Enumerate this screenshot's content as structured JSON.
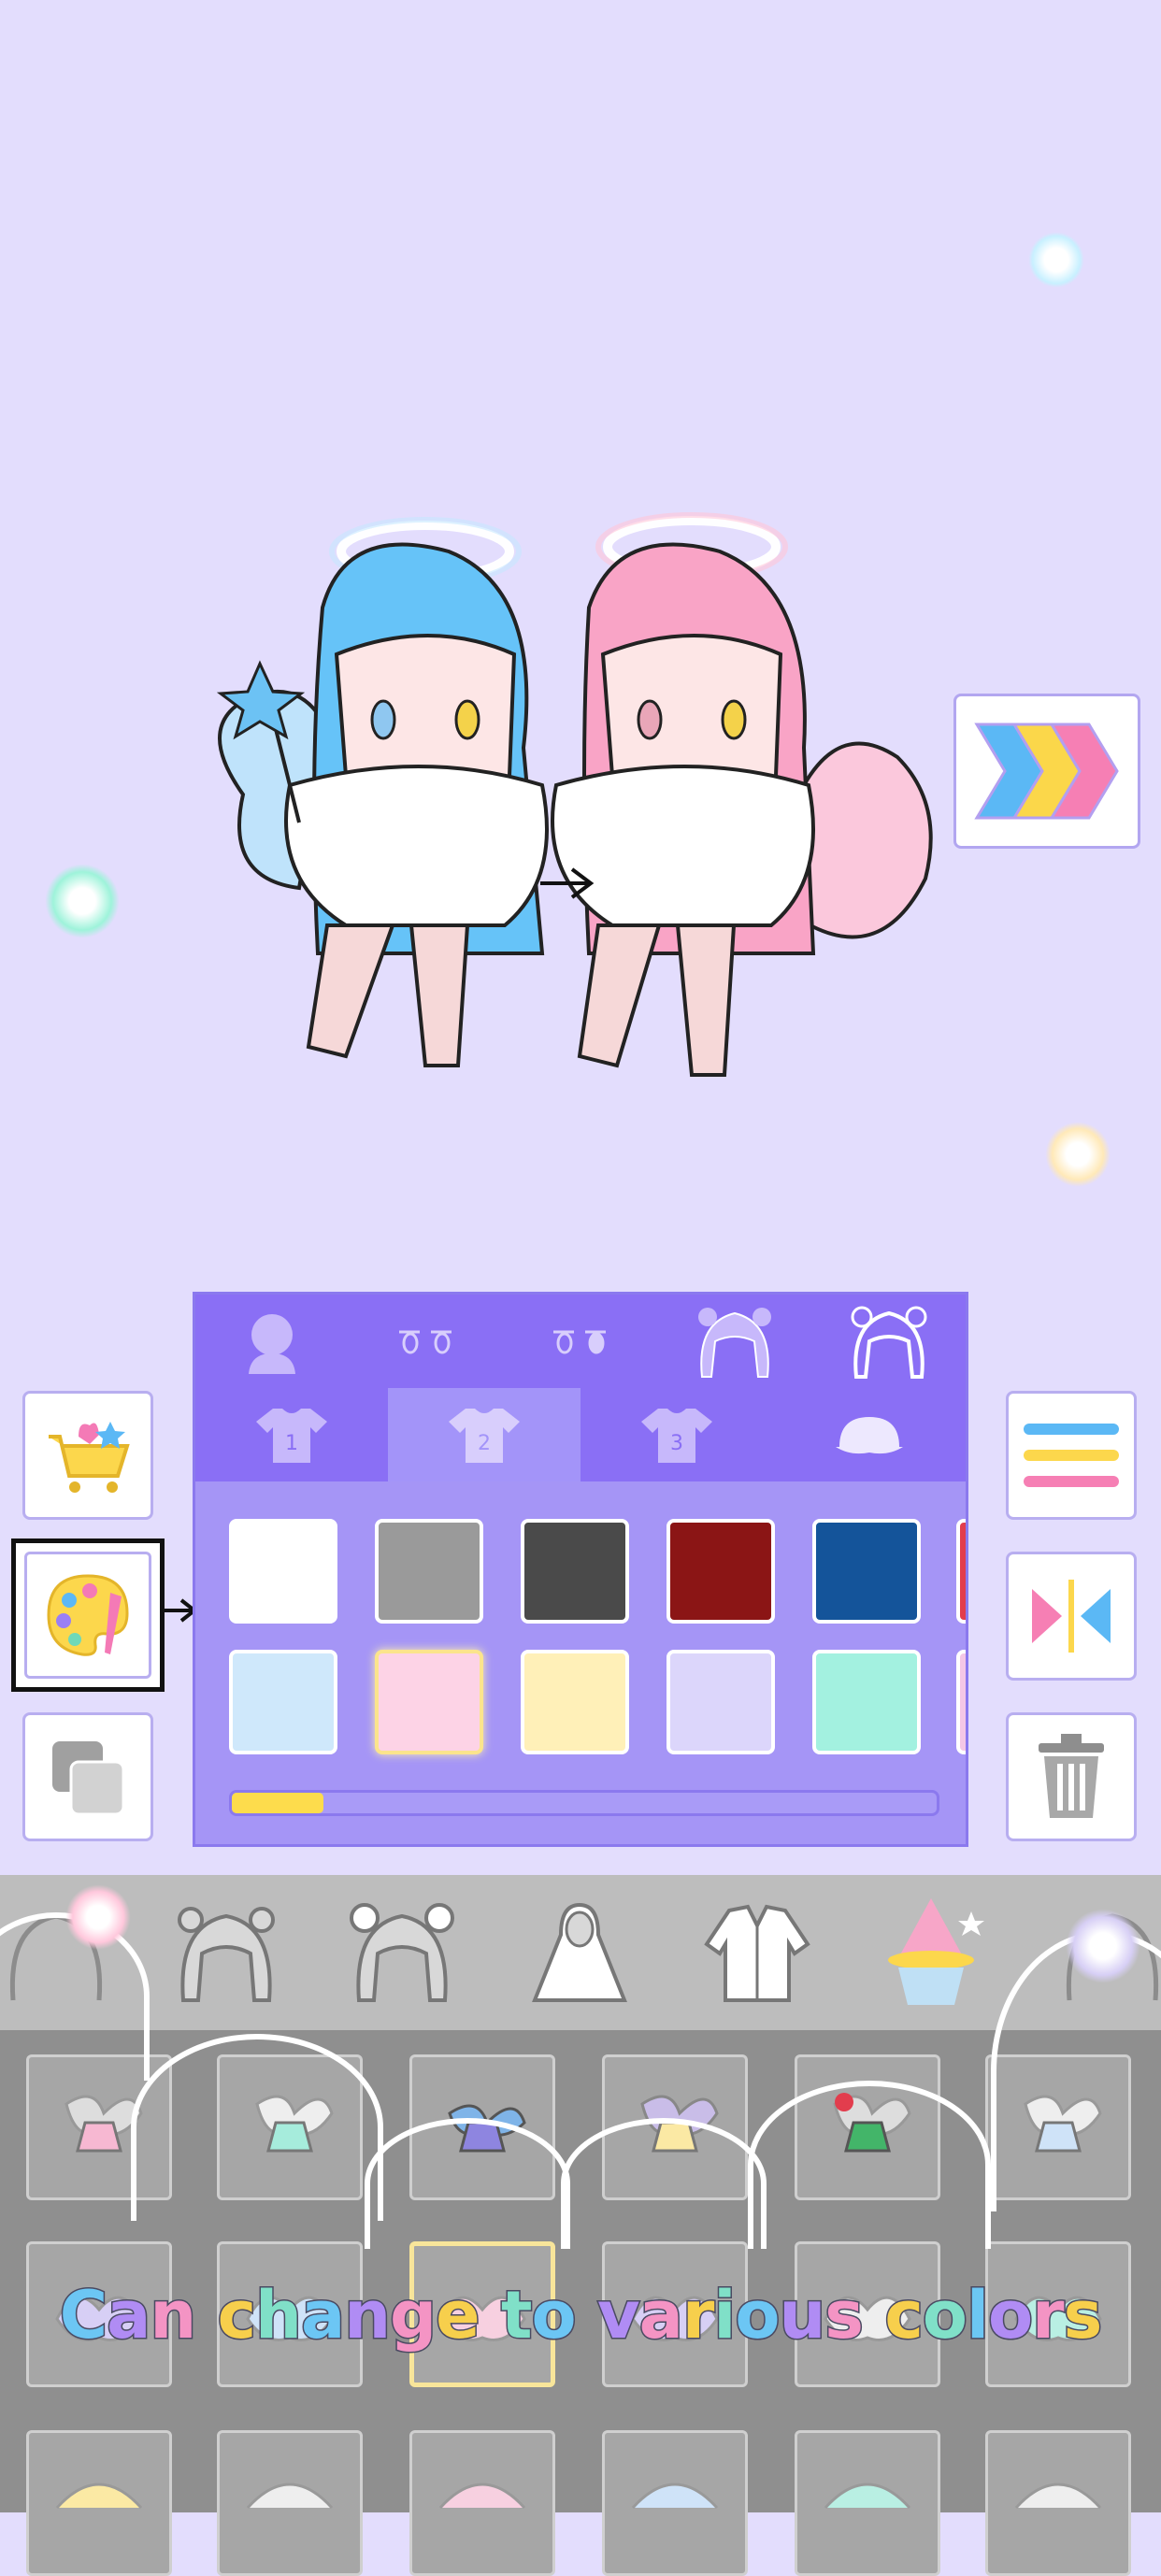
{
  "stage": {
    "characters": [
      "angel-blue",
      "angel-pink"
    ],
    "next_button_icon": "triple-chevron-right-icon"
  },
  "left_tools": [
    {
      "name": "shop-button",
      "icon": "shopping-cart-icon"
    },
    {
      "name": "palette-button",
      "icon": "palette-icon",
      "selected": true
    },
    {
      "name": "layers-button",
      "icon": "layers-icon"
    }
  ],
  "right_tools": [
    {
      "name": "menu-button",
      "icon": "colored-lines-icon"
    },
    {
      "name": "flip-button",
      "icon": "mirror-icon"
    },
    {
      "name": "delete-button",
      "icon": "trash-icon"
    }
  ],
  "color_panel": {
    "categories": [
      "skin-icon",
      "eyes-icon",
      "eyes-alt-icon",
      "hair-front-icon",
      "hair-back-icon"
    ],
    "tabs": [
      {
        "label": "1",
        "icon": "shirt-icon"
      },
      {
        "label": "2",
        "icon": "shirt-icon",
        "active": true
      },
      {
        "label": "3",
        "icon": "shirt-icon"
      },
      {
        "label": "",
        "icon": "cap-icon"
      }
    ],
    "swatches_row1": [
      "#ffffff",
      "#9a9a9a",
      "#4a4a4a",
      "#8b1515",
      "#14549a"
    ],
    "swatches_row2": [
      "#cfe8fb",
      "#fdd3e6",
      "#fff0b8",
      "#dcd6fb",
      "#a3f1e0"
    ],
    "selected_swatch": "#fdd3e6",
    "scroll_progress": 0.13
  },
  "category_strip": [
    "hair-icon",
    "twintails-icon",
    "bun-hair-icon",
    "hoodie-icon",
    "jacket-icon",
    "magic-hat-icon",
    "extra-icon"
  ],
  "items_rows": 3,
  "caption": {
    "text": "Can change to various colors",
    "colors": [
      "#6cc6f4",
      "#b08cf4",
      "#f494c4",
      "#f7cf4c",
      "#80e0c8"
    ]
  },
  "colors": {
    "background": "#e3ddfd",
    "panel": "#a595f6",
    "panel_header": "#8a6ff5",
    "progress": "#fddc4c"
  }
}
